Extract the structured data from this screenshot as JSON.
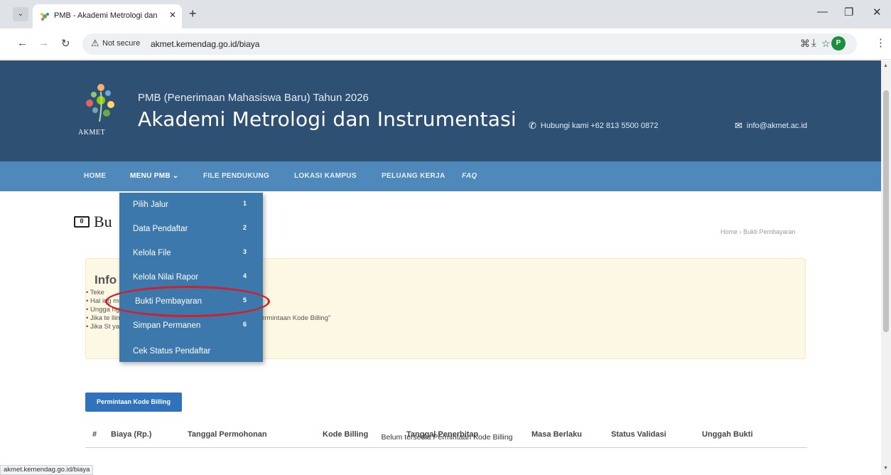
{
  "browser": {
    "tab_title": "PMB - Akademi Metrologi dan",
    "url_security": "Not secure",
    "url": "akmet.kemendag.go.id/biaya",
    "profile_initial": "P",
    "status_url": "akmet.kemendag.go.id/biaya"
  },
  "header": {
    "logo_text": "AKMET",
    "subtitle": "PMB (Penerimaan Mahasiswa Baru) Tahun 2026",
    "title": "Akademi Metrologi dan Instrumentasi",
    "phone": "Hubungi kami +62 813 5500 0872",
    "email": "info@akmet.ac.id"
  },
  "nav": {
    "items": [
      {
        "label": "HOME"
      },
      {
        "label": "MENU PMB ⌄"
      },
      {
        "label": "FILE PENDUKUNG"
      },
      {
        "label": "LOKASI KAMPUS"
      },
      {
        "label": "PELUANG KERJA"
      },
      {
        "label": "FAQ"
      }
    ]
  },
  "dropdown": {
    "items": [
      {
        "label": "Pilih Jalur",
        "num": "1"
      },
      {
        "label": "Data Pendaftar",
        "num": "2"
      },
      {
        "label": "Kelola File",
        "num": "3"
      },
      {
        "label": "Kelola Nilai Rapor",
        "num": "4"
      },
      {
        "label": "Bukti Pembayaran",
        "num": "5"
      },
      {
        "label": "Simpan Permanen",
        "num": "6"
      },
      {
        "label": "Cek Status Pendaftar",
        "num": ""
      }
    ]
  },
  "page": {
    "heading": "Bu",
    "breadcrumb": "Home › Bukti Pembayaran"
  },
  "info": {
    "title": "Info",
    "lines": [
      "• Teke",
      "• Hal                                                  ing muncul",
      "• Ungga                                               nggah Bukti Pembayaran\"",
      "• Jika te                                              lling, lakukan kembali dengan menekan tombol \"Permintaan Kode Billing\"",
      "• Jika St                                              yaran pendaftaran dinyatakan SAH."
    ]
  },
  "billing_button": "Permintaan Kode Billing",
  "table": {
    "headers": [
      "#",
      "Biaya (Rp.)",
      "Tanggal Permohonan",
      "Kode Billing",
      "Tanggal Penerbitan",
      "Masa Berlaku",
      "Status Validasi",
      "Unggah Bukti"
    ],
    "empty_message": "Belum tersedia Permintaan Kode Billing"
  },
  "colors": {
    "header_bg": "#2e5173",
    "navbar_bg": "#4f89bc",
    "dropdown_bg": "#3d78ad",
    "info_bg": "#fcf8e3",
    "button_bg": "#3172bd",
    "highlight": "#d0202a"
  }
}
